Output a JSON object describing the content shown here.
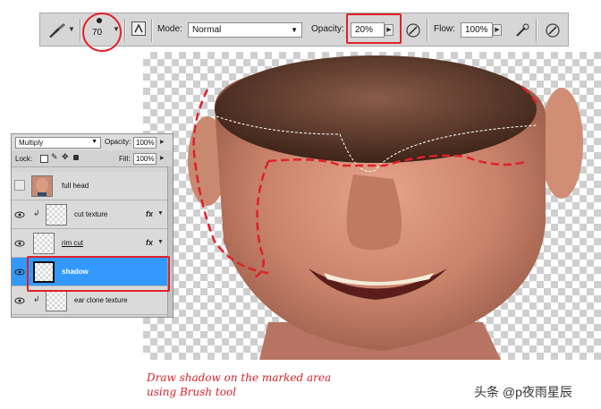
{
  "options_bar": {
    "brush_size": "70",
    "mode_label": "Mode:",
    "mode_value": "Normal",
    "opacity_label": "Opacity:",
    "opacity_value": "20%",
    "flow_label": "Flow:",
    "flow_value": "100%"
  },
  "layers_panel": {
    "blend_mode": "Multiply",
    "opacity_label": "Opacity:",
    "opacity_value": "100%",
    "lock_label": "Lock:",
    "fill_label": "Fill:",
    "fill_value": "100%",
    "layers": [
      {
        "name": "full head",
        "visible": false,
        "selected": false,
        "fx": false,
        "clipped": false
      },
      {
        "name": "cut texture",
        "visible": true,
        "selected": false,
        "fx": true,
        "clipped": true
      },
      {
        "name": "rim cut",
        "visible": true,
        "selected": false,
        "fx": true,
        "clipped": false
      },
      {
        "name": "shadow",
        "visible": true,
        "selected": true,
        "fx": false,
        "clipped": false
      },
      {
        "name": "ear clone texture",
        "visible": true,
        "selected": false,
        "fx": false,
        "clipped": true
      }
    ],
    "fx_label": "fx"
  },
  "caption": {
    "line1": "Draw shadow on the marked area",
    "line2": "using Brush tool"
  },
  "watermark": "头条 @p夜雨星辰",
  "colors": {
    "highlight_red": "#e0202a",
    "selection_blue": "#3399ff"
  }
}
